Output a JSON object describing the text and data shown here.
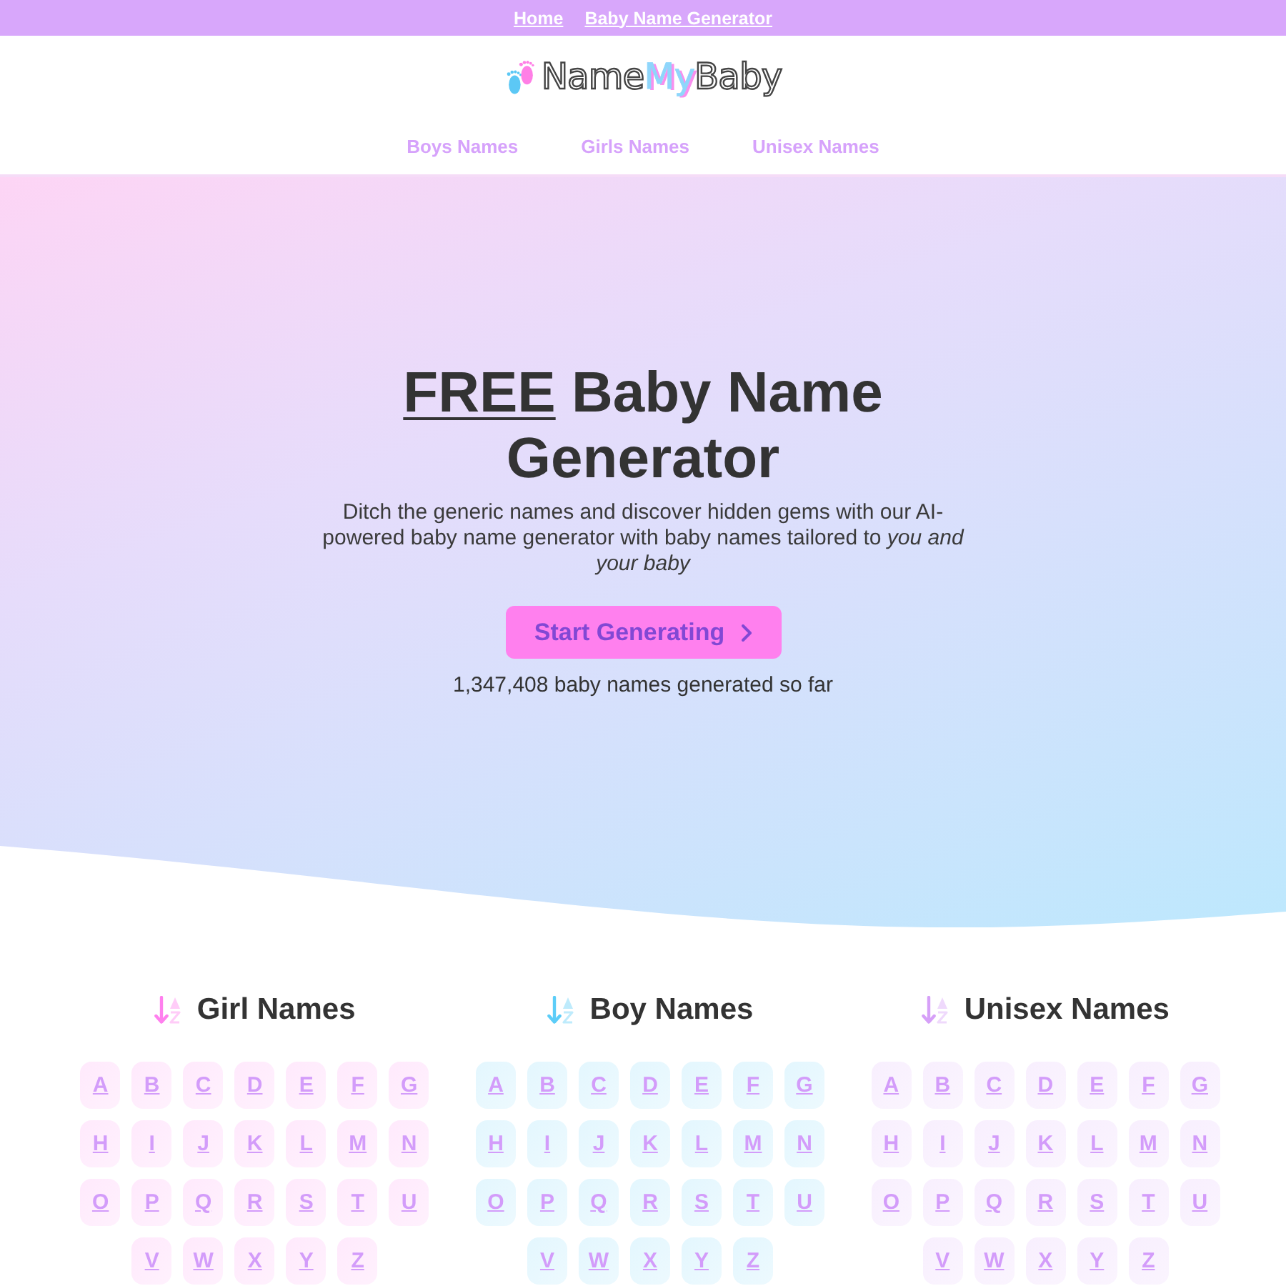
{
  "top_bar": {
    "links": [
      "Home",
      "Baby Name Generator"
    ]
  },
  "logo": {
    "parts": [
      {
        "text": "Name",
        "kind": "outline"
      },
      {
        "text": "My",
        "kind": "accent"
      },
      {
        "text": "Baby",
        "kind": "outline"
      }
    ]
  },
  "nav": {
    "items": [
      "Boys Names",
      "Girls Names",
      "Unisex Names"
    ]
  },
  "hero": {
    "title_highlight": "FREE",
    "title": "Baby Name Generator",
    "description": "Ditch the generic names and discover hidden gems with our AI-powered baby name generator with baby names tailored to *you and your baby*",
    "button": "Start Generating",
    "counter": "1,347,408 baby names generated so far"
  },
  "sections": [
    {
      "title": "Girl Names",
      "color": "#ff80ee",
      "letters": [
        "A",
        "B",
        "C",
        "D",
        "E",
        "F",
        "G",
        "H",
        "I",
        "J",
        "K",
        "L",
        "M",
        "N",
        "O",
        "P",
        "Q",
        "R",
        "S",
        "T",
        "U",
        "V",
        "W",
        "X",
        "Y",
        "Z"
      ]
    },
    {
      "title": "Boy Names",
      "color": "#5ccdf8",
      "letters": [
        "A",
        "B",
        "C",
        "D",
        "E",
        "F",
        "G",
        "H",
        "I",
        "J",
        "K",
        "L",
        "M",
        "N",
        "O",
        "P",
        "Q",
        "R",
        "S",
        "T",
        "U",
        "V",
        "W",
        "X",
        "Y",
        "Z"
      ]
    },
    {
      "title": "Unisex Names",
      "color": "#d6a0f8",
      "letters": [
        "A",
        "B",
        "C",
        "D",
        "E",
        "F",
        "G",
        "H",
        "I",
        "J",
        "K",
        "L",
        "M",
        "N",
        "O",
        "P",
        "Q",
        "R",
        "S",
        "T",
        "U",
        "V",
        "W",
        "X",
        "Y",
        "Z"
      ]
    }
  ]
}
